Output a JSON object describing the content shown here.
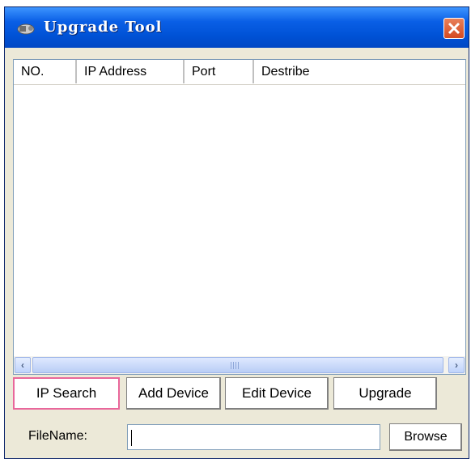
{
  "window": {
    "title": "Upgrade Tool",
    "title_icon": "plug-icon",
    "close_icon": "close-icon"
  },
  "list": {
    "columns": [
      "NO.",
      "IP Address",
      "Port",
      "Destribe"
    ],
    "rows": []
  },
  "buttons": {
    "ip_search": "IP Search",
    "add_device": "Add Device",
    "edit_device": "Edit Device",
    "upgrade": "Upgrade",
    "browse": "Browse"
  },
  "filename": {
    "label": "FileName:",
    "value": ""
  },
  "colors": {
    "title_bar": "#0a5fe6",
    "close_button": "#d44a21",
    "focused_button_border": "#e9679b",
    "window_bg": "#ece9d8"
  }
}
